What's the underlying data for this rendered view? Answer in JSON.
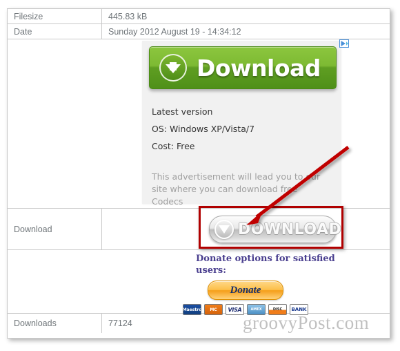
{
  "table": {
    "rows": [
      {
        "label": "Filesize",
        "value": "445.83 kB"
      },
      {
        "label": "Date",
        "value": "Sunday 2012 August 19 - 14:34:12"
      },
      {
        "label": "",
        "value": ""
      },
      {
        "label": "Download",
        "value": ""
      },
      {
        "label": "",
        "value": ""
      },
      {
        "label": "Downloads",
        "value": "77124"
      }
    ],
    "filesize_label": "Filesize",
    "filesize_value": "445.83 kB",
    "date_label": "Date",
    "date_value": "Sunday 2012 August 19 - 14:34:12",
    "download_label": "Download",
    "downloads_label": "Downloads",
    "downloads_value": "77124"
  },
  "advertisement": {
    "button_label": "Download",
    "icon_name": "download-arrow-icon",
    "adchoices_icon": "adchoices-icon",
    "line_1": "Latest version",
    "line_2": "OS: Windows XP/Vista/7",
    "line_3": "Cost: Free",
    "disclaimer": "This advertisement will lead you to our site where you can download free Codecs",
    "background_color": "#f1f1f1",
    "accent_color": "#6cb033"
  },
  "real_download": {
    "button_label": "DOWNLOAD",
    "icon_name": "download-triangle-icon",
    "highlight_color": "#b00000"
  },
  "donate": {
    "heading": "Donate options for satisfied users:",
    "button_label": "Donate",
    "button_color": "#f59e19",
    "cards": [
      {
        "name": "maestro-card-icon",
        "label": "Maestro"
      },
      {
        "name": "mastercard-card-icon",
        "label": "MC"
      },
      {
        "name": "visa-card-icon",
        "label": "VISA"
      },
      {
        "name": "amex-card-icon",
        "label": "AMEX"
      },
      {
        "name": "discover-card-icon",
        "label": "DISC"
      },
      {
        "name": "bank-card-icon",
        "label": "BANK"
      }
    ]
  },
  "annotation": {
    "arrow_color": "#c00000",
    "arrow_name": "red-pointer-arrow",
    "box_name": "red-highlight-box"
  },
  "watermark": {
    "text": "groovyPost.com"
  }
}
